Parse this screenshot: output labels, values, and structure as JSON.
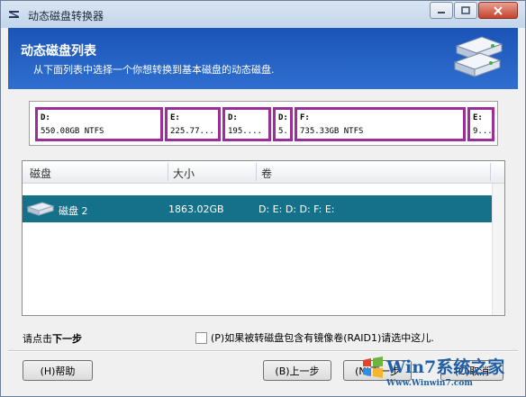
{
  "window": {
    "title": "动态磁盘转换器"
  },
  "header": {
    "title": "动态磁盘列表",
    "subtitle": "从下面列表中选择一个你想转换到基本磁盘的动态磁盘."
  },
  "partitions": [
    {
      "letter": "D:",
      "info": "550.08GB NTFS"
    },
    {
      "letter": "E:",
      "info": "225.77..."
    },
    {
      "letter": "D:",
      "info": "195...."
    },
    {
      "letter": "D:",
      "info": "5."
    },
    {
      "letter": "F:",
      "info": "735.33GB NTFS"
    },
    {
      "letter": "E:",
      "info": "9..."
    }
  ],
  "disk_list": {
    "columns": [
      "磁盘",
      "大小",
      "卷"
    ],
    "rows": [
      {
        "disk": "磁盘 2",
        "size": "1863.02GB",
        "volumes": "D:  E:  D:  D:  F:  E:"
      }
    ]
  },
  "hint": {
    "prefix": "请点击",
    "emphasis": "下一步"
  },
  "raid_checkbox": {
    "label": "(P)如果被转磁盘包含有镜像卷(RAID1)请选中这儿.",
    "checked": false
  },
  "buttons": {
    "help": "(H)帮助",
    "back": "(B)上一步",
    "next": "(N)下一步",
    "cancel": "(C)取消"
  },
  "watermark": {
    "logo": "Win7系统之家",
    "url": "Www.Winwin7.com"
  },
  "colors": {
    "header_blue": "#1a54b6",
    "selection": "#15718a",
    "partition_border": "#9c2e9c"
  }
}
